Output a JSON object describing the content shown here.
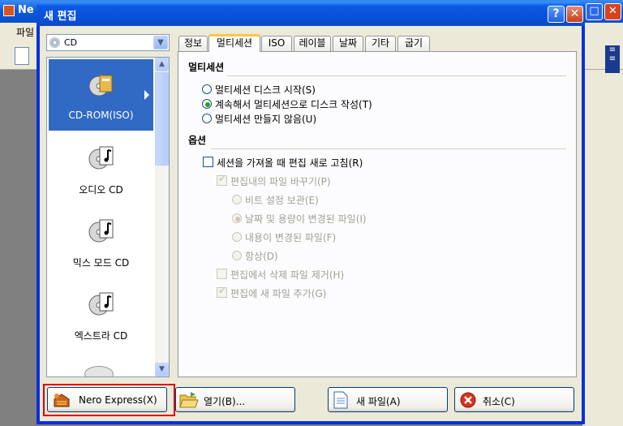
{
  "background_app": {
    "title": "Ne",
    "menu_first": "파일",
    "title_buttons": [
      "□",
      "✕"
    ]
  },
  "dialog": {
    "title": "새 편집",
    "help_button": "?",
    "close_button": "✕"
  },
  "disc_type_select": {
    "value": "CD"
  },
  "project_list": {
    "items": [
      {
        "label": "CD-ROM(ISO)",
        "selected": true,
        "icon": "cdrom-iso-icon"
      },
      {
        "label": "오디오 CD",
        "selected": false,
        "icon": "audio-cd-icon"
      },
      {
        "label": "믹스 모드 CD",
        "selected": false,
        "icon": "mixed-mode-cd-icon"
      },
      {
        "label": "엑스트라 CD",
        "selected": false,
        "icon": "extra-cd-icon"
      }
    ]
  },
  "tabs": [
    {
      "label": "정보",
      "active": false
    },
    {
      "label": "멀티세션",
      "active": true
    },
    {
      "label": "ISO",
      "active": false
    },
    {
      "label": "레이블",
      "active": false
    },
    {
      "label": "날짜",
      "active": false
    },
    {
      "label": "기타",
      "active": false
    },
    {
      "label": "굽기",
      "active": false
    }
  ],
  "multisession": {
    "section_title": "멀티세션",
    "options": [
      {
        "label": "멀티세션 디스크 시작(S)",
        "checked": false
      },
      {
        "label": "계속해서 멀티세션으로 디스크 작성(T)",
        "checked": true
      },
      {
        "label": "멀티세션 만들지 않음(U)",
        "checked": false
      }
    ]
  },
  "options_section": {
    "section_title": "옵션",
    "refresh_on_import": {
      "label": "세션을 가져올 때 편집 새로 고침(R)",
      "checked": false
    },
    "replace_files": {
      "label": "편집내의 파일 바꾸기(P)",
      "checked": true,
      "disabled": true
    },
    "replace_radios": [
      {
        "label": "비트 설정 보관(E)",
        "checked": false
      },
      {
        "label": "날짜 및 용량이 변경된 파일(I)",
        "checked": true
      },
      {
        "label": "내용이 변경된 파일(F)",
        "checked": false
      },
      {
        "label": "항상(D)",
        "checked": false
      }
    ],
    "remove_deleted": {
      "label": "편집에서 삭제 파일 제거(H)",
      "checked": false,
      "disabled": true
    },
    "add_new_files": {
      "label": "편집에 새 파일 추가(G)",
      "checked": true,
      "disabled": true
    }
  },
  "buttons": {
    "nero_express": "Nero Express(X)",
    "open": "열기(B)...",
    "new_file": "새 파일(A)",
    "cancel": "취소(C)"
  },
  "colors": {
    "selection": "#316ac5",
    "highlight_box": "#e00000",
    "tab_accent": "#ffc83c"
  }
}
